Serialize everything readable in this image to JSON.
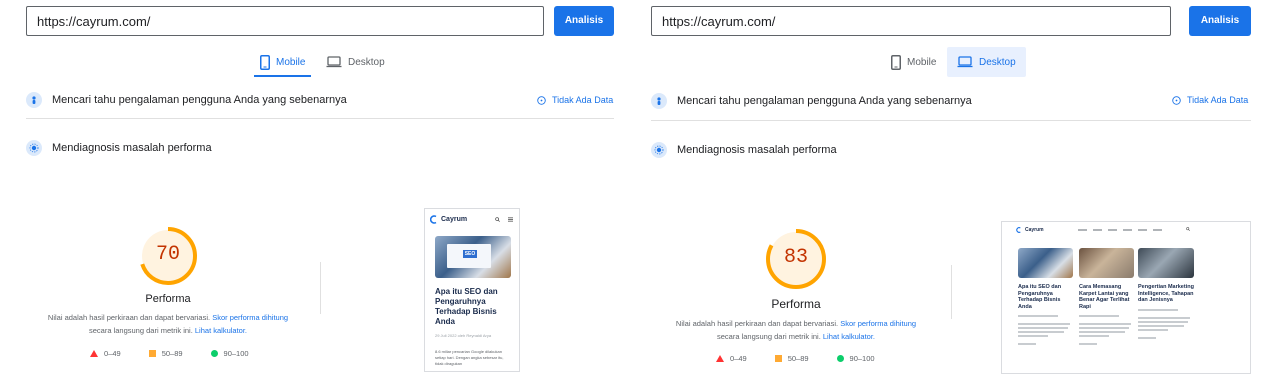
{
  "left": {
    "url_value": "https://cayrum.com/",
    "analyze_label": "Analisis",
    "tabs": [
      {
        "label": "Mobile",
        "active": true,
        "icon": "phone-icon"
      },
      {
        "label": "Desktop",
        "active": false,
        "icon": "laptop-icon"
      }
    ],
    "experience_text": "Mencari tahu pengalaman pengguna Anda yang sebenarnya",
    "no_data_label": "Tidak Ada Data",
    "diagnose_text": "Mendiagnosis masalah performa",
    "score": 70,
    "score_label": "Performa",
    "note_text": "Nilai adalah hasil perkiraan dan dapat bervariasi.",
    "note_link1": "Skor performa dihitung",
    "note_text2": "secara langsung dari metrik ini.",
    "note_link2": "Lihat kalkulator.",
    "legend": [
      "0–49",
      "50–89",
      "90–100"
    ],
    "screenshot": {
      "brand": "Cayrum",
      "article_title": "Apa itu SEO dan Pengaruhnya Terhadap Bisnis Anda",
      "meta": "29 Juli 2022 oleh Reynaldi Arya",
      "excerpt": "8.6 miliar pencarian Google dilakukan setiap hari. Dengan angka sebesar itu, tidak diragukan"
    }
  },
  "right": {
    "url_value": "https://cayrum.com/",
    "analyze_label": "Analisis",
    "tabs": [
      {
        "label": "Mobile",
        "active": false,
        "icon": "phone-icon"
      },
      {
        "label": "Desktop",
        "active": true,
        "icon": "laptop-icon"
      }
    ],
    "experience_text": "Mencari tahu pengalaman pengguna Anda yang sebenarnya",
    "no_data_label": "Tidak Ada Data",
    "diagnose_text": "Mendiagnosis masalah performa",
    "score": 83,
    "score_label": "Performa",
    "note_text": "Nilai adalah hasil perkiraan dan dapat bervariasi.",
    "note_link1": "Skor performa dihitung",
    "note_text2": "secara langsung dari metrik ini.",
    "note_link2": "Lihat kalkulator.",
    "legend": [
      "0–49",
      "50–89",
      "90–100"
    ],
    "screenshot": {
      "brand": "Cayrum",
      "cards": [
        {
          "title": "Apa itu SEO dan Pengaruhnya Terhadap Bisnis Anda"
        },
        {
          "title": "Cara Memasang Karpet Lantai yang Benar Agar Terlihat Rapi"
        },
        {
          "title": "Pengertian Marketing Intelligence, Tahapan dan Jenisnya"
        }
      ]
    }
  },
  "colors": {
    "accent": "#1a73e8",
    "gauge_average": "#ffa400",
    "gauge_track": "#fff3e0",
    "score_text": "#c33300",
    "fail": "#ff3333",
    "average": "#ffaa33",
    "pass": "#0cce6b"
  }
}
